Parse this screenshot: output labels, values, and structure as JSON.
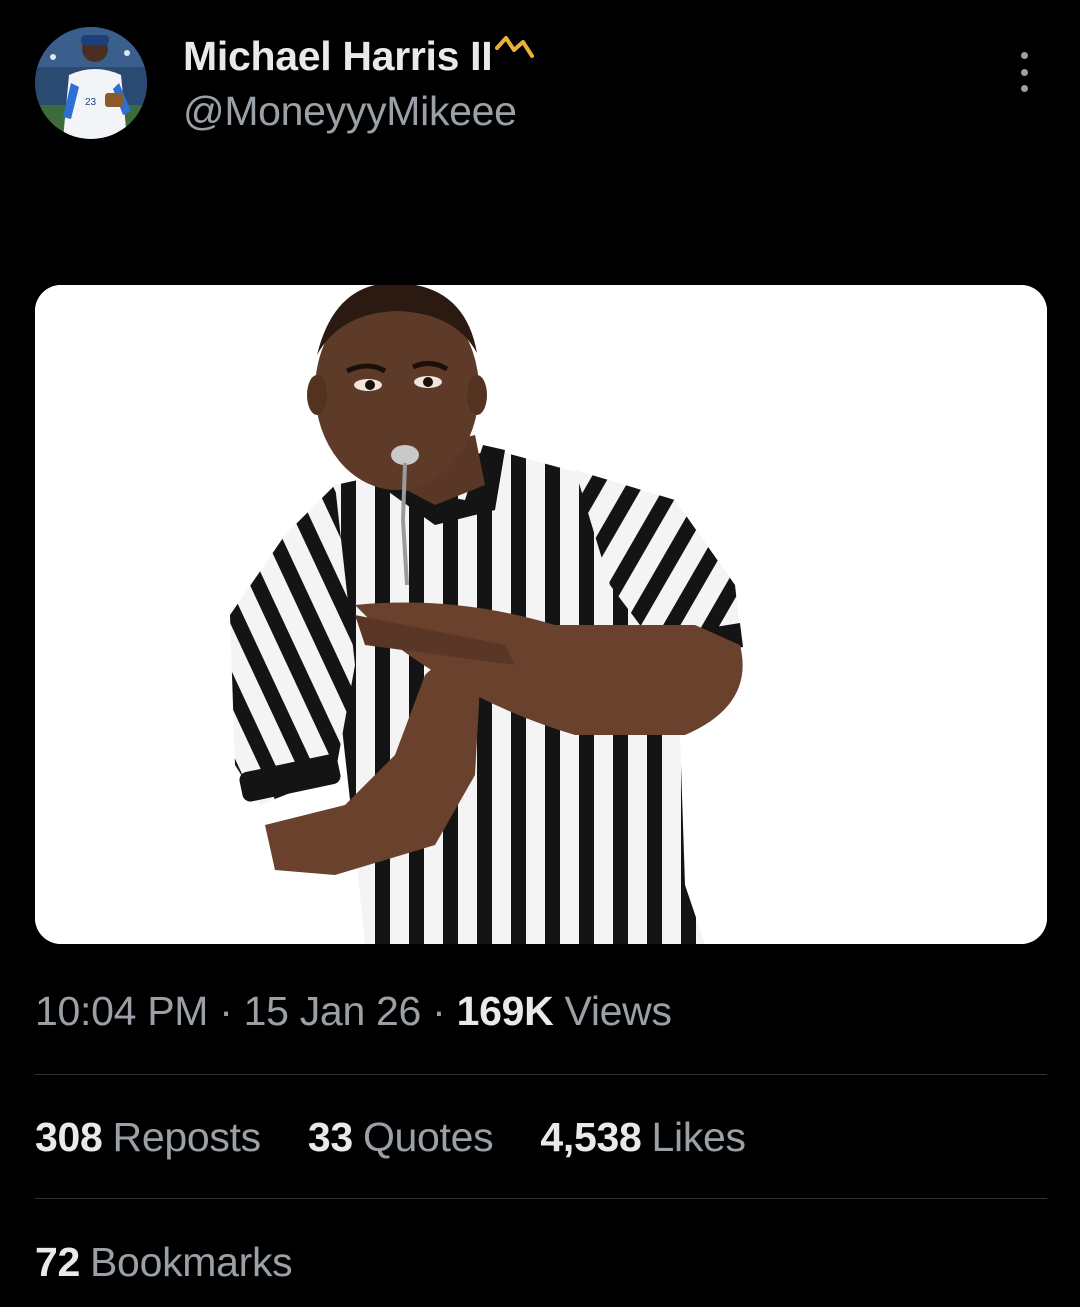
{
  "author": {
    "name": "Michael Harris II",
    "handle": "@MoneyyyMikeee",
    "badge_icon": "crown-zigzag-icon",
    "badge_color": "#e6b23a"
  },
  "post": {
    "time": "10:04 PM",
    "date": "15 Jan 26",
    "views_count": "169K",
    "views_label": "Views",
    "separator": "·"
  },
  "stats": {
    "reposts_count": "308",
    "reposts_label": "Reposts",
    "quotes_count": "33",
    "quotes_label": "Quotes",
    "likes_count": "4,538",
    "likes_label": "Likes",
    "bookmarks_count": "72",
    "bookmarks_label": "Bookmarks"
  },
  "colors": {
    "background": "#000000",
    "primary_text": "#e7e9ea",
    "secondary_text": "#9aa0a6",
    "divider": "#2f3336"
  }
}
